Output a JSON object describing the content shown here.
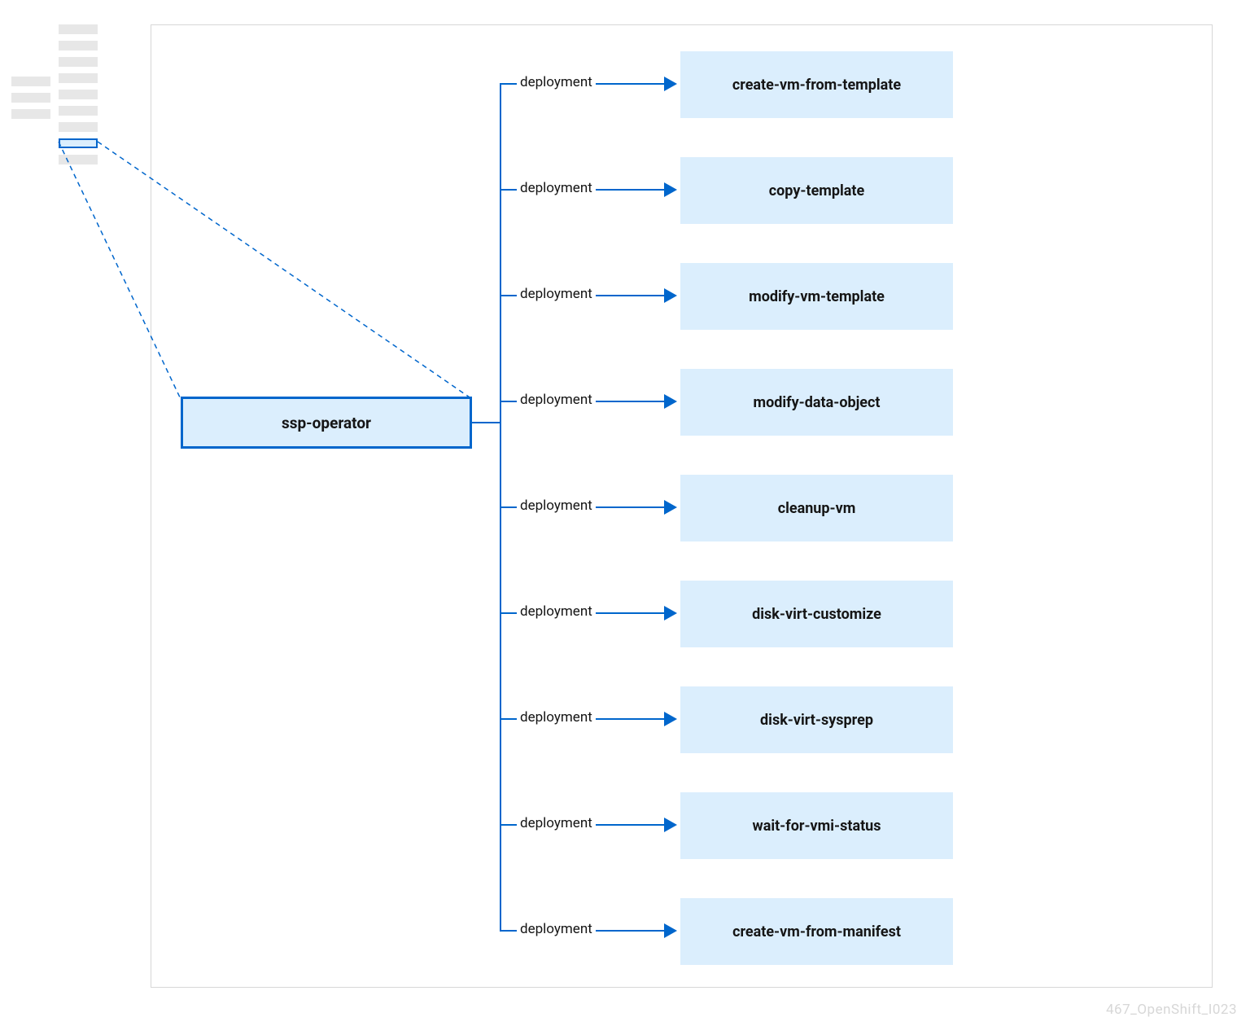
{
  "main_node": {
    "label": "ssp-operator"
  },
  "edge_label": "deployment",
  "targets": [
    "create-vm-from-template",
    "copy-template",
    "modify-vm-template",
    "modify-data-object",
    "cleanup-vm",
    "disk-virt-customize",
    "disk-virt-sysprep",
    "wait-for-vmi-status",
    "create-vm-from-manifest"
  ],
  "footer": "467_OpenShift_I023",
  "colors": {
    "accent": "#0066cc",
    "box_fill": "#dbeefd",
    "muted": "#e7e7e7",
    "border": "#d7d7d7"
  },
  "legend": {
    "left_col_bars": 3,
    "right_col_bars_before": 7,
    "right_col_highlight_index": 7,
    "right_col_bars_after": 1
  }
}
